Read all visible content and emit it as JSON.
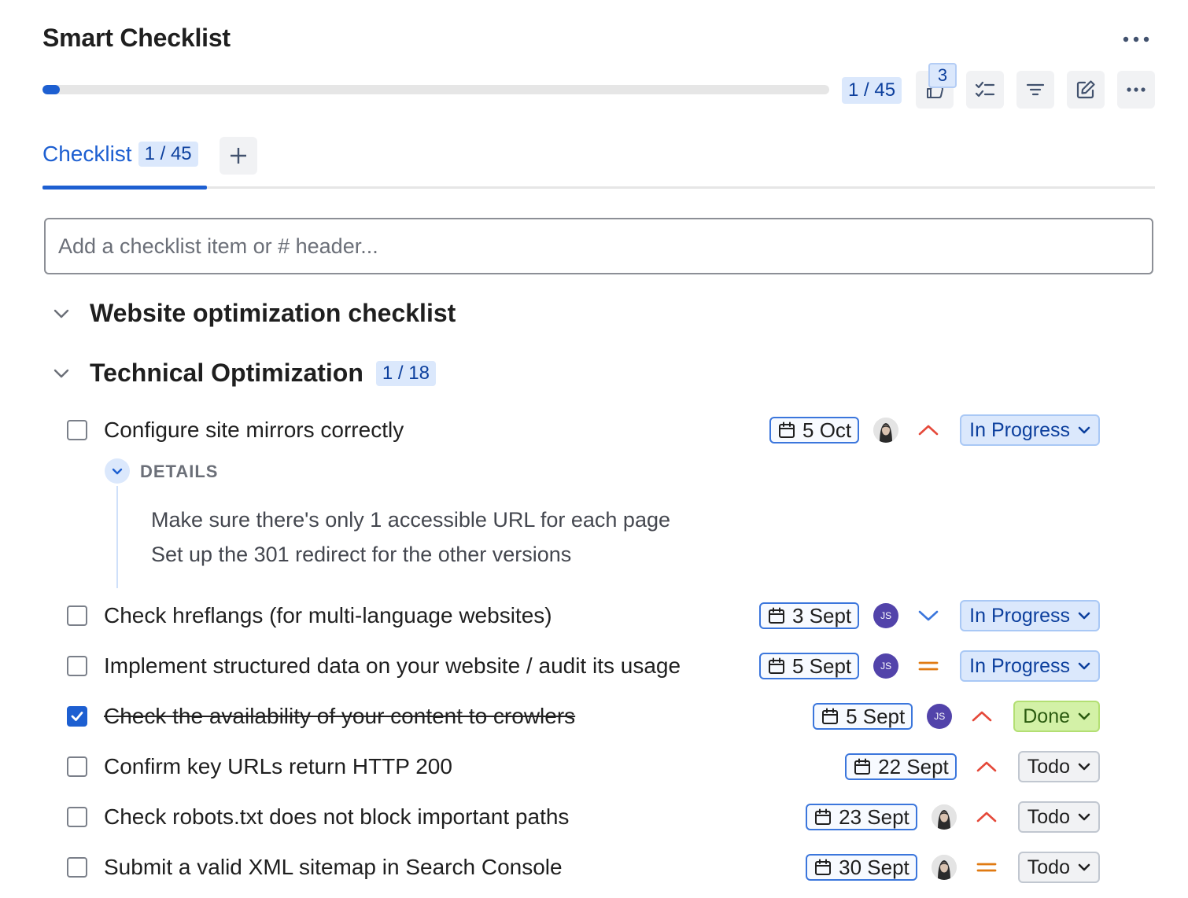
{
  "header": {
    "title": "Smart Checklist",
    "progress_text": "1 / 45",
    "progress_fraction": 0.022,
    "notification_count": "3"
  },
  "tabs": [
    {
      "label": "Checklist",
      "count": "1 / 45"
    }
  ],
  "input": {
    "placeholder": "Add a checklist item or # header..."
  },
  "sections": [
    {
      "title": "Website optimization checklist"
    },
    {
      "title": "Technical Optimization",
      "count": "1 / 18"
    }
  ],
  "items": [
    {
      "text": "Configure site mirrors correctly",
      "checked": false,
      "date": "5 Oct",
      "assignee": "photo",
      "priority": "high",
      "status": "In Progress"
    },
    {
      "text": "Check hreflangs (for multi-language websites)",
      "checked": false,
      "date": "3 Sept",
      "assignee": "JS",
      "priority": "low",
      "status": "In Progress"
    },
    {
      "text": "Implement structured data on your website / audit its usage",
      "checked": false,
      "date": "5 Sept",
      "assignee": "JS",
      "priority": "medium",
      "status": "In Progress"
    },
    {
      "text": "Check the availability of your content to crowlers",
      "checked": true,
      "date": "5 Sept",
      "assignee": "JS",
      "priority": "high",
      "status": "Done"
    },
    {
      "text": "Confirm key URLs return HTTP 200",
      "checked": false,
      "date": "22 Sept",
      "assignee": "",
      "priority": "high",
      "status": "Todo"
    },
    {
      "text": "Check robots.txt does not block important paths",
      "checked": false,
      "date": "23 Sept",
      "assignee": "photo",
      "priority": "high",
      "status": "Todo"
    },
    {
      "text": "Submit a valid XML sitemap in Search Console",
      "checked": false,
      "date": "30 Sept",
      "assignee": "photo",
      "priority": "medium",
      "status": "Todo"
    }
  ],
  "details": {
    "label": "DETAILS",
    "lines": [
      "Make sure there's only 1 accessible URL for each page",
      "Set up the 301 redirect for the other versions"
    ]
  },
  "colors": {
    "accent": "#1d5fd1",
    "priority_high": "#e5493a",
    "priority_medium": "#e07a12",
    "priority_low": "#3b76dc",
    "assignee_js": "#5243aa"
  }
}
